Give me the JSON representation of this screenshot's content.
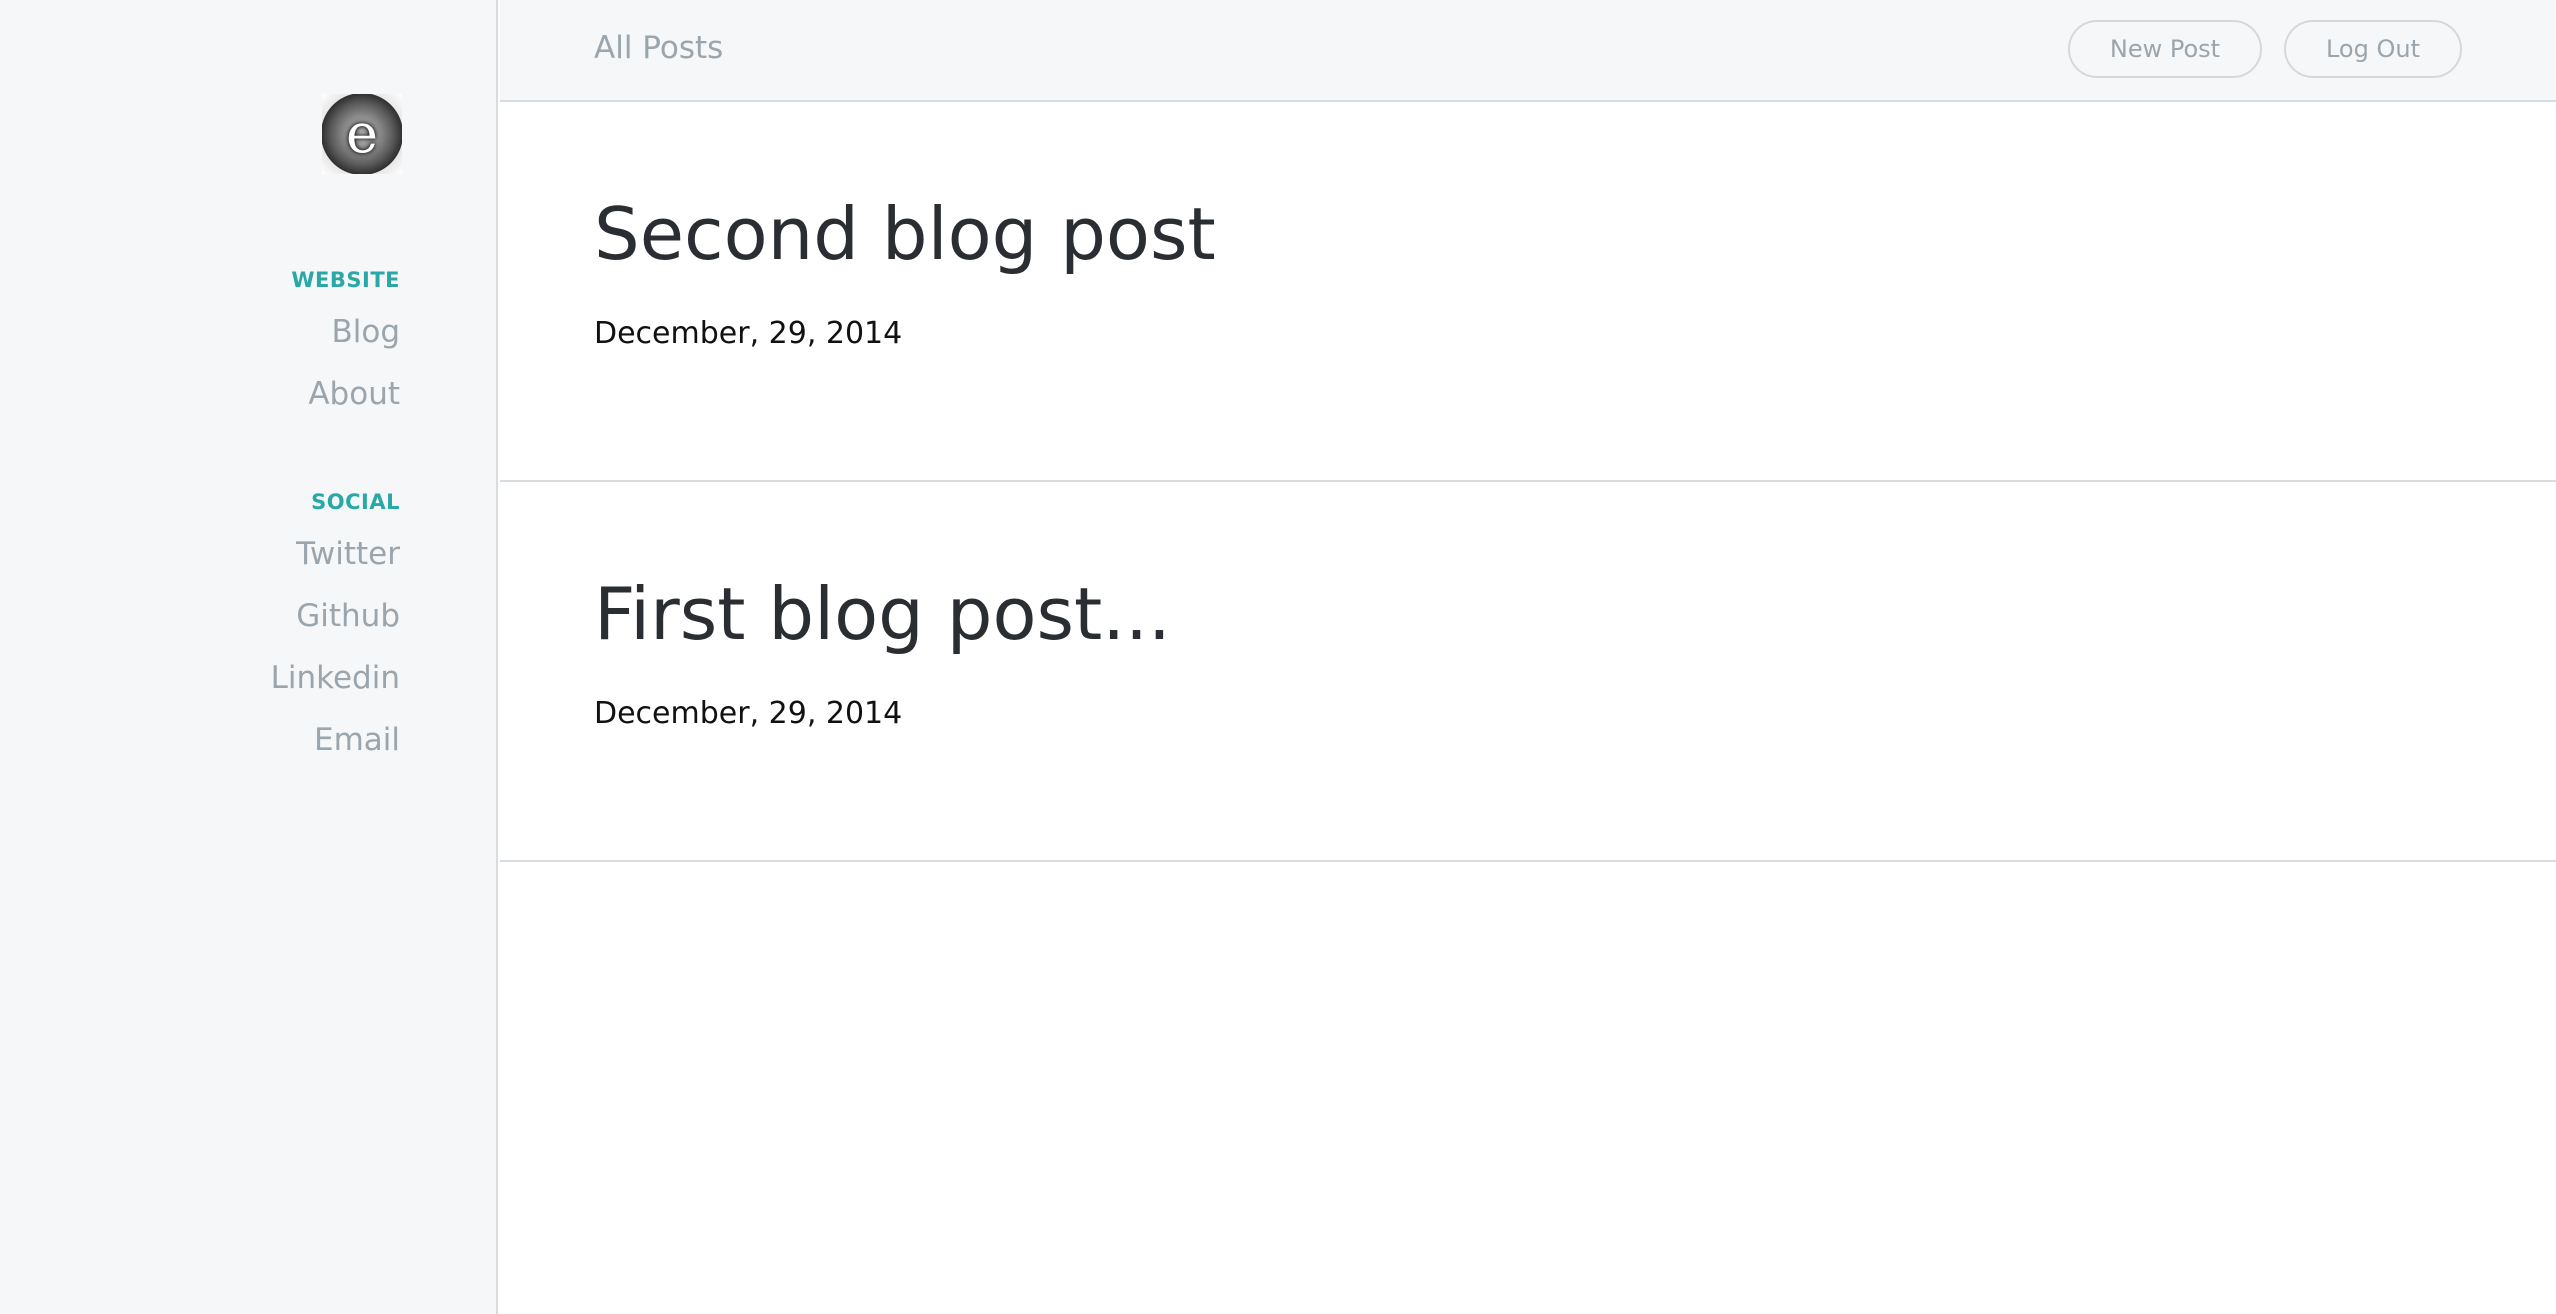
{
  "sidebar": {
    "logo_letter": "e",
    "sections": [
      {
        "heading": "WEBSITE",
        "links": [
          "Blog",
          "About"
        ]
      },
      {
        "heading": "SOCIAL",
        "links": [
          "Twitter",
          "Github",
          "Linkedin",
          "Email"
        ]
      }
    ]
  },
  "header": {
    "title": "All Posts",
    "new_post_label": "New Post",
    "log_out_label": "Log Out"
  },
  "posts": [
    {
      "title": "Second blog post",
      "date": "December, 29, 2014"
    },
    {
      "title": "First blog post...",
      "date": "December, 29, 2014"
    }
  ],
  "colors": {
    "accent": "#2aa8a8",
    "muted_text": "#9aa5ad",
    "sidebar_bg": "#f5f7f8",
    "divider": "#d8dcdf"
  }
}
